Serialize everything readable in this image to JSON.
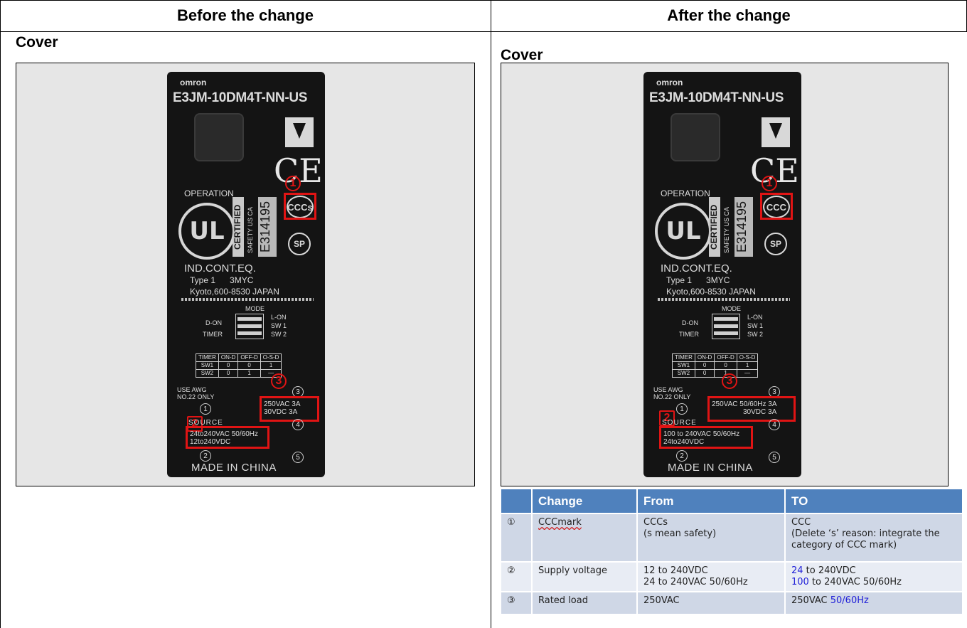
{
  "columns": {
    "before_title": "Before the change",
    "after_title": "After the change"
  },
  "before": {
    "section_label": "Cover",
    "device": {
      "brand": "omron",
      "model": "E3JM-10DM4T-NN-US",
      "operation": "OPERATION",
      "ul_text": "UL",
      "certified": "CERTIFIED",
      "safety": "SAFETY US CA",
      "cert_number": "E314195",
      "ce": "CE",
      "ccc_mark": "CCCs",
      "csa_mark": "SP",
      "ind": "IND.CONT.EQ.",
      "type_line": "Type 1      3MYC",
      "address": "Kyoto,600-8530 JAPAN",
      "mode": "MODE",
      "d_on": "D-ON",
      "timer": "TIMER",
      "l_on": "L-ON",
      "sw1": "SW 1",
      "sw2": "SW 2",
      "mini_head": [
        "TIMER",
        "ON-D",
        "OFF-D",
        "O-S-D"
      ],
      "mini_row1": [
        "SW1",
        "0",
        "0",
        "1"
      ],
      "mini_row2": [
        "SW2",
        "0",
        "1",
        "—"
      ],
      "awg": "USE AWG\nNO.22 ONLY",
      "source": "SOURCE",
      "supply_line1": "24to240VAC 50/60Hz",
      "supply_line2": "12to240VDC",
      "load_line1": "250VAC  3A",
      "load_line2": "30VDC  3A",
      "made_in": "MADE IN CHINA",
      "terminal_nums": [
        "1",
        "2",
        "3",
        "4",
        "5"
      ],
      "marker1": "1",
      "marker2": "2",
      "marker3": "3"
    }
  },
  "after": {
    "section_label": "Cover",
    "device": {
      "brand": "omron",
      "model": "E3JM-10DM4T-NN-US",
      "operation": "OPERATION",
      "ul_text": "UL",
      "certified": "CERTIFIED",
      "safety": "SAFETY US CA",
      "cert_number": "E314195",
      "ce": "CE",
      "ccc_mark": "CCC",
      "csa_mark": "SP",
      "ind": "IND.CONT.EQ.",
      "type_line": "Type 1      3MYC",
      "address": "Kyoto,600-8530 JAPAN",
      "mode": "MODE",
      "d_on": "D-ON",
      "timer": "TIMER",
      "l_on": "L-ON",
      "sw1": "SW 1",
      "sw2": "SW 2",
      "mini_head": [
        "TIMER",
        "ON-D",
        "OFF-D",
        "O-S-D"
      ],
      "mini_row1": [
        "SW1",
        "0",
        "0",
        "1"
      ],
      "mini_row2": [
        "SW2",
        "0",
        "1",
        "—"
      ],
      "awg": "USE AWG\nNO.22 ONLY",
      "source": "SOURCE",
      "supply_line1": "100 to 240VAC 50/60Hz",
      "supply_line2": "24to240VDC",
      "load_line1": "250VAC 50/60Hz  3A",
      "load_line2": "30VDC  3A",
      "made_in": "MADE IN CHINA",
      "terminal_nums": [
        "1",
        "2",
        "3",
        "4",
        "5"
      ],
      "marker1": "1",
      "marker2": "2",
      "marker3": "3"
    }
  },
  "change_table": {
    "headers": [
      "",
      "Change",
      "From",
      "TO"
    ],
    "rows": [
      {
        "num": "①",
        "change": "CCCmark",
        "from": [
          "CCCs",
          "(s mean safety)"
        ],
        "to": [
          "CCC",
          "(Delete ‘s’ reason: integrate the",
          "category of CCC mark)"
        ]
      },
      {
        "num": "②",
        "change": "Supply voltage",
        "from": [
          "12 to 240VDC",
          "24 to 240VAC 50/60Hz"
        ],
        "to_1_blue": "24",
        "to_1_rest": " to 240VDC",
        "to_2_blue": "100",
        "to_2_rest": " to 240VAC 50/60Hz"
      },
      {
        "num": "③",
        "change": "Rated load",
        "from": [
          "250VAC"
        ],
        "to_rest": "250VAC ",
        "to_blue": "50/60Hz"
      }
    ]
  },
  "colors": {
    "header_blue": "#4f81bd",
    "row_dark": "#cfd7e6",
    "row_light": "#e8ecf4",
    "highlight_red": "#e01414",
    "changed_blue": "#1f1fd8"
  }
}
